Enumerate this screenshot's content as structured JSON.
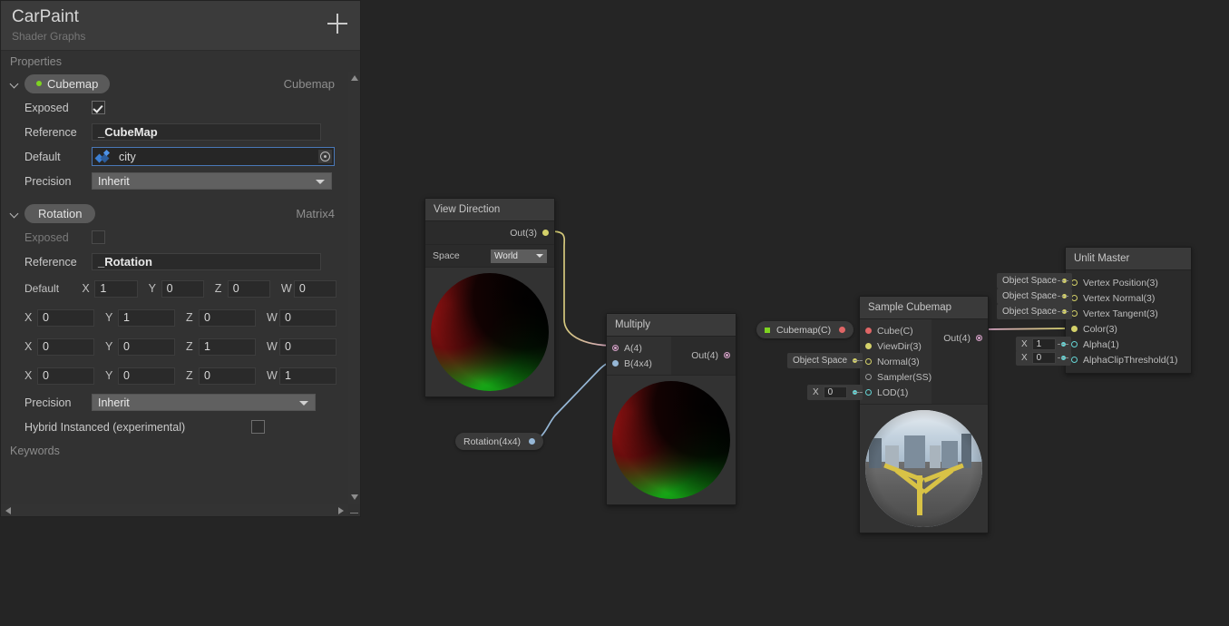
{
  "blackboard": {
    "title": "CarPaint",
    "subtitle": "Shader Graphs",
    "add_label": "+",
    "properties_label": "Properties",
    "keywords_label": "Keywords",
    "properties": [
      {
        "name": "Cubemap",
        "type": "Cubemap",
        "exposed_label": "Exposed",
        "exposed": true,
        "reference_label": "Reference",
        "reference": "_CubeMap",
        "default_label": "Default",
        "default_value": "city",
        "default_icon": "cubemap-asset-icon",
        "precision_label": "Precision",
        "precision": "Inherit"
      },
      {
        "name": "Rotation",
        "type": "Matrix4",
        "exposed_label": "Exposed",
        "exposed": false,
        "reference_label": "Reference",
        "reference": "_Rotation",
        "default_label": "Default",
        "axis_labels": [
          "X",
          "Y",
          "Z",
          "W"
        ],
        "matrix": [
          [
            "1",
            "0",
            "0",
            "0"
          ],
          [
            "0",
            "1",
            "0",
            "0"
          ],
          [
            "0",
            "0",
            "1",
            "0"
          ],
          [
            "0",
            "0",
            "0",
            "1"
          ]
        ],
        "precision_label": "Precision",
        "precision": "Inherit",
        "hybrid_label": "Hybrid Instanced (experimental)",
        "hybrid": false
      }
    ]
  },
  "graph": {
    "nodes": {
      "view_direction": {
        "title": "View Direction",
        "out_port": "Out(3)",
        "space_label": "Space",
        "space_value": "World"
      },
      "multiply": {
        "title": "Multiply",
        "in_a": "A(4)",
        "in_b": "B(4x4)",
        "out_port": "Out(4)"
      },
      "sample_cubemap": {
        "title": "Sample Cubemap",
        "in_cube": "Cube(C)",
        "in_viewdir": "ViewDir(3)",
        "in_normal": "Normal(3)",
        "in_sampler": "Sampler(SS)",
        "in_lod": "LOD(1)",
        "out_port": "Out(4)",
        "normal_default": "Object Space",
        "lod_axis": "X",
        "lod_value": "0"
      },
      "unlit_master": {
        "title": "Unlit Master",
        "ports": [
          {
            "label": "Vertex Position(3)",
            "default": "Object Space",
            "kind": "space"
          },
          {
            "label": "Vertex Normal(3)",
            "default": "Object Space",
            "kind": "space"
          },
          {
            "label": "Vertex Tangent(3)",
            "default": "Object Space",
            "kind": "space"
          },
          {
            "label": "Color(3)",
            "default": "",
            "kind": "connected"
          },
          {
            "label": "Alpha(1)",
            "default": "1",
            "axis": "X",
            "kind": "number"
          },
          {
            "label": "AlphaClipThreshold(1)",
            "default": "0",
            "axis": "X",
            "kind": "number"
          }
        ]
      }
    },
    "tokens": {
      "cubemap_property": "Cubemap(C)",
      "rotation_property": "Rotation(4x4)"
    }
  },
  "colors": {
    "accent_green": "#7ed321",
    "port_pink": "#d6a2c8",
    "port_blue": "#96b7d6",
    "port_yellow": "#d4d16a",
    "port_red": "#e06666",
    "port_cyan": "#66d4d4",
    "panel_bg": "#323232",
    "graph_bg": "#252525",
    "field_focus": "#4a78b8"
  }
}
